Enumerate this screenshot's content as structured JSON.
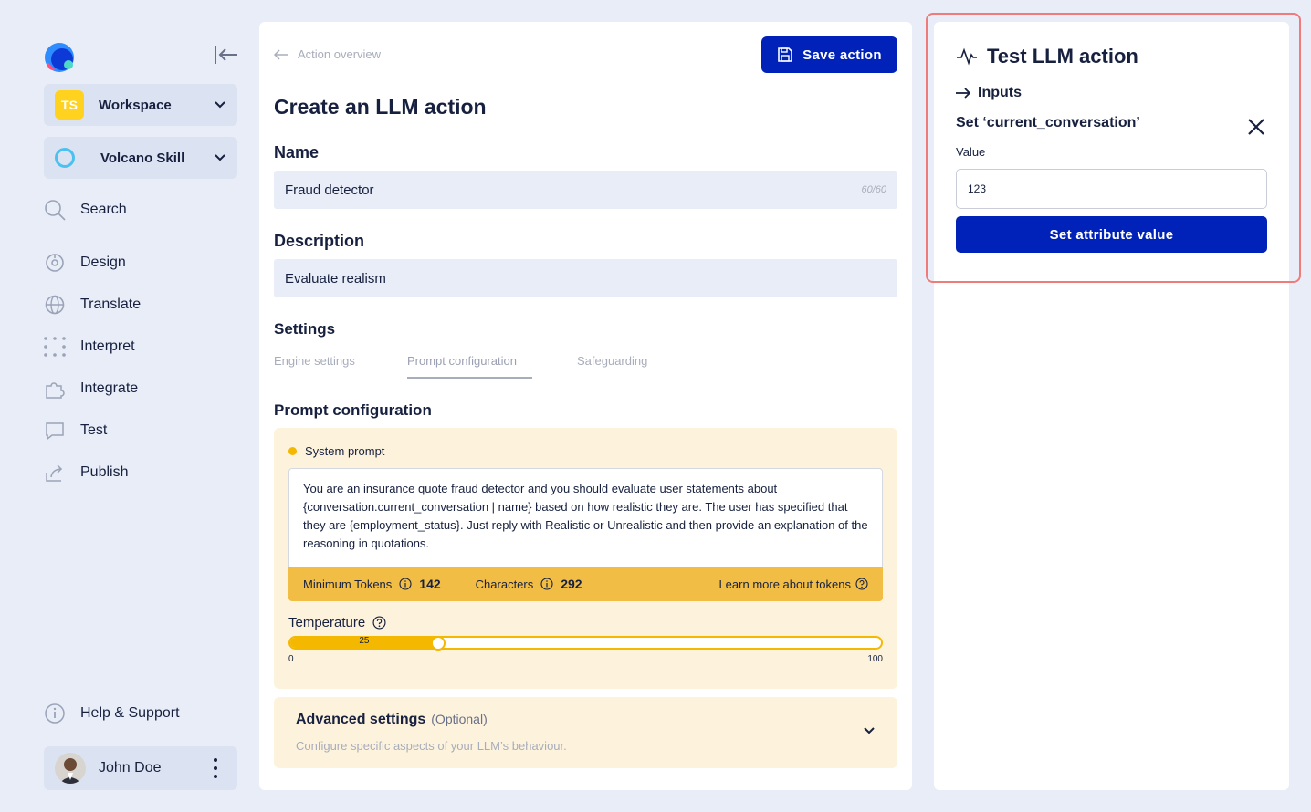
{
  "sidebar": {
    "workspace": {
      "initials": "TS",
      "label": "Workspace"
    },
    "skill": {
      "label": "Volcano Skill"
    },
    "nav": [
      {
        "label": "Search",
        "icon": "search-icon"
      },
      {
        "label": "Design",
        "icon": "design-icon"
      },
      {
        "label": "Translate",
        "icon": "globe-icon"
      },
      {
        "label": "Interpret",
        "icon": "dots-grid-icon"
      },
      {
        "label": "Integrate",
        "icon": "puzzle-icon"
      },
      {
        "label": "Test",
        "icon": "chat-icon"
      },
      {
        "label": "Publish",
        "icon": "share-icon"
      }
    ],
    "help": {
      "label": "Help & Support",
      "icon": "info-icon"
    },
    "user": {
      "name": "John Doe"
    }
  },
  "main": {
    "breadcrumb": "Action overview",
    "save_label": "Save action",
    "title": "Create an LLM action",
    "name": {
      "label": "Name",
      "value": "Fraud detector",
      "counter": "60/60"
    },
    "description": {
      "label": "Description",
      "value": "Evaluate realism"
    },
    "settings": {
      "label": "Settings",
      "tabs": [
        "Engine settings",
        "Prompt configuration",
        "Safeguarding"
      ],
      "active_tab": "Prompt configuration"
    },
    "prompt_config": {
      "heading": "Prompt configuration",
      "system_prompt_label": "System prompt",
      "system_prompt": "You are an insurance quote fraud detector and you should evaluate user statements about {conversation.current_conversation | name} based on how realistic they are. The user has specified that they are {employment_status}. Just reply with Realistic or Unrealistic and then provide an explanation of the reasoning in quotations.",
      "min_tokens_label": "Minimum Tokens",
      "min_tokens": "142",
      "characters_label": "Characters",
      "characters": "292",
      "learn_more": "Learn more about tokens",
      "temperature_label": "Temperature",
      "temperature": 25,
      "temperature_min": "0",
      "temperature_max": "100"
    },
    "advanced": {
      "title": "Advanced settings",
      "optional": "(Optional)",
      "description": "Configure specific aspects of your LLM’s behaviour."
    }
  },
  "right_panel": {
    "title": "Test LLM action",
    "inputs_label": "Inputs",
    "set_label": "Set ‘current_conversation’",
    "value_label": "Value",
    "value": "123",
    "button_label": "Set attribute value"
  },
  "colors": {
    "primary": "#0022b8",
    "accent_yellow": "#f5b800",
    "highlight_border": "#ef7b7b",
    "background": "#e9edf7"
  }
}
